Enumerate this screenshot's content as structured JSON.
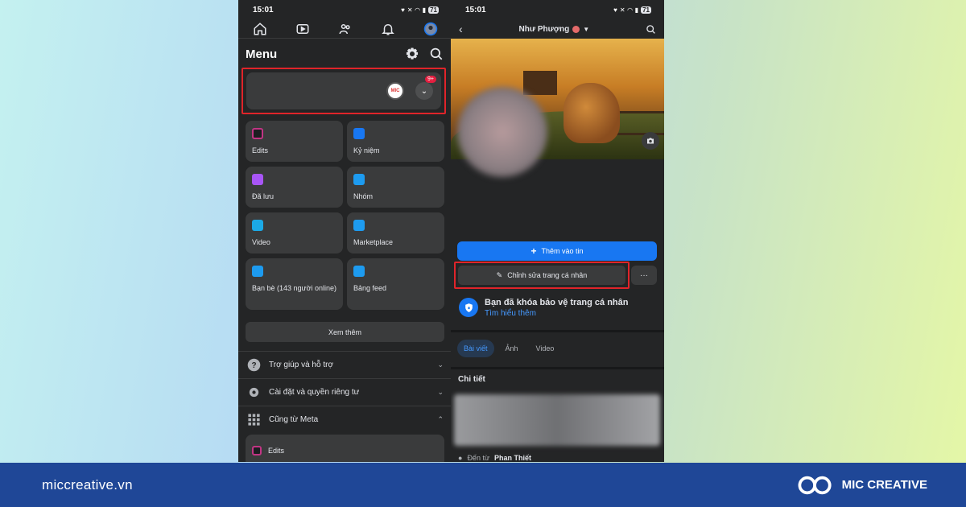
{
  "left": {
    "status": {
      "time": "15:01",
      "battery": "71"
    },
    "menu_title": "Menu",
    "profile": {
      "badge": "9+"
    },
    "shortcuts": [
      {
        "label": "Edits",
        "color": "#1c1e21",
        "icon": "edits-icon"
      },
      {
        "label": "Kỷ niệm",
        "color": "#1877f2",
        "icon": "memories-icon"
      },
      {
        "label": "Đã lưu",
        "color": "#a855f7",
        "icon": "saved-icon"
      },
      {
        "label": "Nhóm",
        "color": "#1d9bf0",
        "icon": "groups-icon"
      },
      {
        "label": "Video",
        "color": "#1ba9e6",
        "icon": "video-icon"
      },
      {
        "label": "Marketplace",
        "color": "#1d9bf0",
        "icon": "marketplace-icon"
      },
      {
        "label": "Bạn bè (143 người online)",
        "color": "#1d9bf0",
        "icon": "friends-icon"
      },
      {
        "label": "Bảng feed",
        "color": "#1d9bf0",
        "icon": "feed-icon"
      }
    ],
    "see_more": "Xem thêm",
    "sections": [
      {
        "label": "Trợ giúp và hỗ trợ",
        "icon": "help-icon",
        "chevron": "⌄"
      },
      {
        "label": "Cài đặt và quyền riêng tư",
        "icon": "settings-gear-icon",
        "chevron": "⌄"
      },
      {
        "label": "Cũng từ Meta",
        "icon": "grid-icon",
        "chevron": "⌃"
      }
    ],
    "edits_card": "Edits"
  },
  "right": {
    "status": {
      "time": "15:01",
      "battery": "71"
    },
    "profile_name": "Như Phượng",
    "add_story": "Thêm vào tin",
    "edit_profile": "Chỉnh sửa trang cá nhân",
    "more": "···",
    "lock_title": "Bạn đã khóa bảo vệ trang cá nhân",
    "lock_link": "Tìm hiểu thêm",
    "tabs": [
      "Bài viết",
      "Ảnh",
      "Video"
    ],
    "details_title": "Chi tiết",
    "origin_prefix": "Đến từ",
    "origin_place": "Phan Thiết"
  },
  "footer": {
    "website": "miccreative.vn",
    "brand": "MIC CREATIVE"
  }
}
